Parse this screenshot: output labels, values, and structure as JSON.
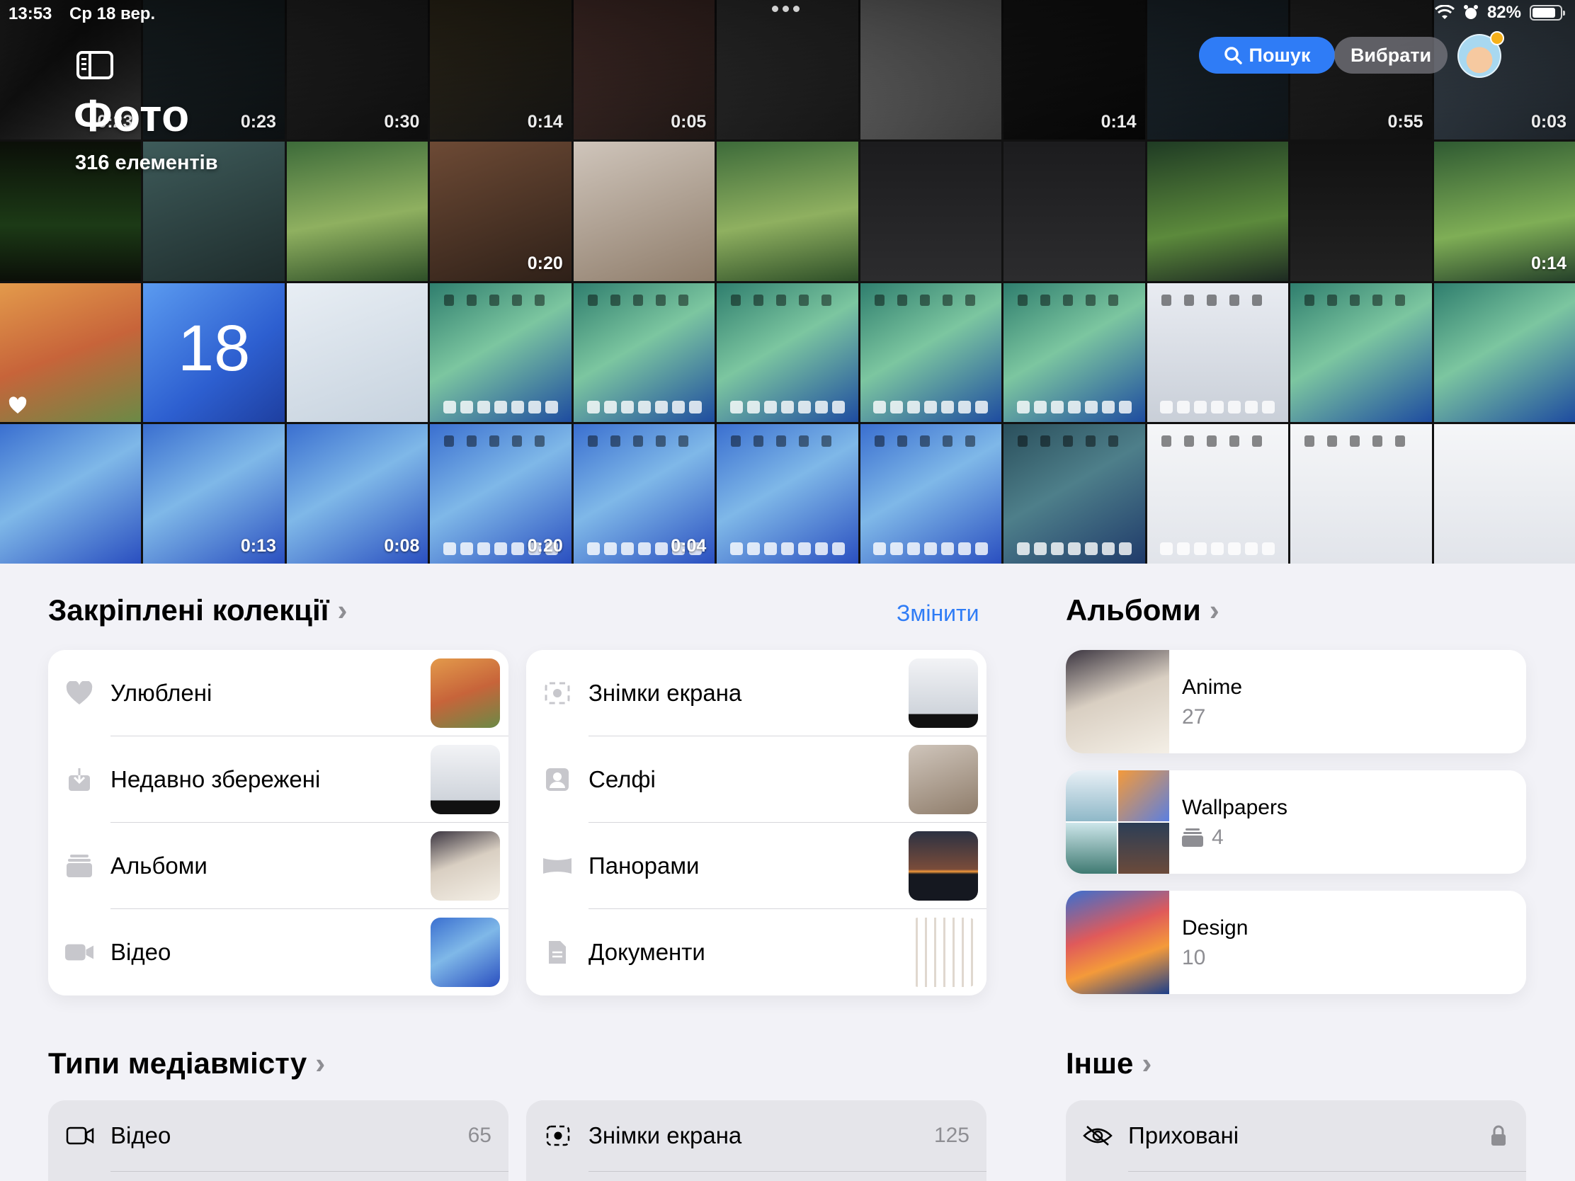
{
  "status": {
    "time": "13:53",
    "date": "Ср 18 вер.",
    "battery": "82%",
    "battery_level": 0.82
  },
  "header": {
    "title": "Фото",
    "count": "316 елементів",
    "search_label": "Пошук",
    "select_label": "Вибрати"
  },
  "grid": {
    "tiles": [
      {
        "bg": "linear-gradient(135deg,#2a2a2a,#111 40%,#333)",
        "dur": "0:23"
      },
      {
        "bg": "linear-gradient(160deg,#1f2a2e,#0c1012)",
        "dur": "0:23"
      },
      {
        "bg": "linear-gradient(160deg,#2c2c2c,#0d0d0d)",
        "dur": "0:30"
      },
      {
        "bg": "linear-gradient(160deg,#3b3320,#121212)",
        "dur": "0:14"
      },
      {
        "bg": "linear-gradient(160deg,#5a3a35,#1d1614)",
        "dur": "0:05"
      },
      {
        "bg": "linear-gradient(160deg,#3a3a3a,#151515)",
        "dur": ""
      },
      {
        "bg": "linear-gradient(160deg,#8a8a8a,#3a3a3a)",
        "dur": ""
      },
      {
        "bg": "linear-gradient(160deg,#1a1a1a,#050505)",
        "dur": "0:14"
      },
      {
        "bg": "linear-gradient(160deg,#24313a,#0e1418)",
        "dur": ""
      },
      {
        "bg": "linear-gradient(160deg,#2d2d2d,#0f0f0f)",
        "dur": "0:55"
      },
      {
        "bg": "linear-gradient(160deg,#4b5966,#1c2228)",
        "dur": "0:03"
      },
      {
        "bg": "linear-gradient(180deg,#0b0f08,#1c3a16 60%,#0b0f08)",
        "dur": ""
      },
      {
        "bg": "linear-gradient(160deg,#3e5b5a,#1e2c2c)",
        "dur": ""
      },
      {
        "bg": "linear-gradient(170deg,#3d6b3a,#8fb060 55%,#2e4f28)",
        "dur": ""
      },
      {
        "bg": "linear-gradient(160deg,#6d4a35,#2e2018)",
        "dur": "0:20"
      },
      {
        "bg": "linear-gradient(160deg,#cfc5bb,#8f7d6b)",
        "dur": ""
      },
      {
        "bg": "linear-gradient(170deg,#3d6b3a,#8fb060 55%,#2e4f28)",
        "dur": ""
      },
      {
        "bg": "linear-gradient(180deg,#1c1c1e,#2c2c2e)",
        "dur": ""
      },
      {
        "bg": "linear-gradient(180deg,#1c1c1e,#2c2c2e)",
        "dur": ""
      },
      {
        "bg": "linear-gradient(170deg,#1f3b24,#5c8a3c 60%,#1d2a22)",
        "dur": ""
      },
      {
        "bg": "linear-gradient(180deg,#111,#222)",
        "dur": ""
      },
      {
        "bg": "linear-gradient(170deg,#2f5a32,#7fae56 60%,#25412a)",
        "dur": "0:14"
      },
      {
        "bg": "linear-gradient(160deg,#e39a4b,#c7643a 50%,#6b8a46)",
        "dur": ""
      },
      {
        "bg": "linear-gradient(140deg,#5b9bf0,#2d5fd0 60%,#1e3fa0)",
        "dur": ""
      },
      {
        "bg": "linear-gradient(160deg,#e8eef4,#c6d2de)",
        "dur": ""
      },
      {
        "bg": "linear-gradient(150deg,#2f7e6e,#7cc6a0 45%,#1e4ca0)",
        "dur": ""
      },
      {
        "bg": "linear-gradient(150deg,#2f7e6e,#7cc6a0 45%,#1e4ca0)",
        "dur": ""
      },
      {
        "bg": "linear-gradient(150deg,#2f7e6e,#7cc6a0 45%,#1e4ca0)",
        "dur": ""
      },
      {
        "bg": "linear-gradient(150deg,#2f7e6e,#7cc6a0 45%,#1e4ca0)",
        "dur": ""
      },
      {
        "bg": "linear-gradient(150deg,#2f7e6e,#7cc6a0 45%,#1e4ca0)",
        "dur": ""
      },
      {
        "bg": "linear-gradient(180deg,#e9ecf2,#c9cfd8)",
        "dur": ""
      },
      {
        "bg": "linear-gradient(150deg,#2f7e6e,#7cc6a0 45%,#1e4ca0)",
        "dur": ""
      },
      {
        "bg": "linear-gradient(150deg,#2f7e6e,#7cc6a0 45%,#1e4ca0)",
        "dur": ""
      },
      {
        "bg": "linear-gradient(150deg,#3a6fd0,#7fb8e8 45%,#2a4fc0)",
        "dur": ""
      },
      {
        "bg": "linear-gradient(150deg,#3a6fd0,#7fb8e8 45%,#2a4fc0)",
        "dur": "0:13"
      },
      {
        "bg": "linear-gradient(150deg,#3a6fd0,#7fb8e8 45%,#2a4fc0)",
        "dur": "0:08"
      },
      {
        "bg": "linear-gradient(150deg,#3a6fd0,#7fb8e8 45%,#2a4fc0)",
        "dur": "0:20"
      },
      {
        "bg": "linear-gradient(150deg,#3a6fd0,#7fb8e8 45%,#2a4fc0)",
        "dur": "0:04"
      },
      {
        "bg": "linear-gradient(150deg,#3a6fd0,#7fb8e8 45%,#2a4fc0)",
        "dur": ""
      },
      {
        "bg": "linear-gradient(150deg,#3a6fd0,#7fb8e8 45%,#2a4fc0)",
        "dur": ""
      },
      {
        "bg": "linear-gradient(150deg,#2a4f5c,#4e7f8a 45%,#1f3a6a)",
        "dur": ""
      },
      {
        "bg": "linear-gradient(180deg,#f5f6f8,#e1e4ea)",
        "dur": ""
      },
      {
        "bg": "linear-gradient(180deg,#f5f6f8,#e1e4ea)",
        "dur": ""
      },
      {
        "bg": "linear-gradient(180deg,#f5f6f8,#e1e4ea)",
        "dur": ""
      }
    ],
    "big_number": "18"
  },
  "pinned": {
    "title": "Закріплені колекції",
    "edit_label": "Змінити",
    "left": [
      {
        "label": "Улюблені",
        "icon": "heart-icon"
      },
      {
        "label": "Недавно збережені",
        "icon": "download-icon"
      },
      {
        "label": "Альбоми",
        "icon": "albums-icon"
      },
      {
        "label": "Відео",
        "icon": "video-icon"
      }
    ],
    "right": [
      {
        "label": "Знімки екрана",
        "icon": "screenshot-icon"
      },
      {
        "label": "Селфі",
        "icon": "selfie-icon"
      },
      {
        "label": "Панорами",
        "icon": "panorama-icon"
      },
      {
        "label": "Документи",
        "icon": "document-icon"
      }
    ]
  },
  "albums": {
    "title": "Альбоми",
    "items": [
      {
        "name": "Anime",
        "count": "27"
      },
      {
        "name": "Wallpapers",
        "count": "4"
      },
      {
        "name": "Design",
        "count": "10"
      }
    ]
  },
  "media_types": {
    "title": "Типи медіавмісту",
    "items": [
      {
        "label": "Відео",
        "count": "65",
        "icon": "video-outline-icon"
      },
      {
        "label": "Знімки екрана",
        "count": "125",
        "icon": "screenshot-outline-icon"
      }
    ]
  },
  "other": {
    "title": "Інше",
    "items": [
      {
        "label": "Приховані",
        "icon": "hidden-eye-icon"
      }
    ]
  },
  "colors": {
    "accent": "#2f7cf6",
    "background": "#f2f2f7",
    "secondary_text": "#8e8e93"
  }
}
